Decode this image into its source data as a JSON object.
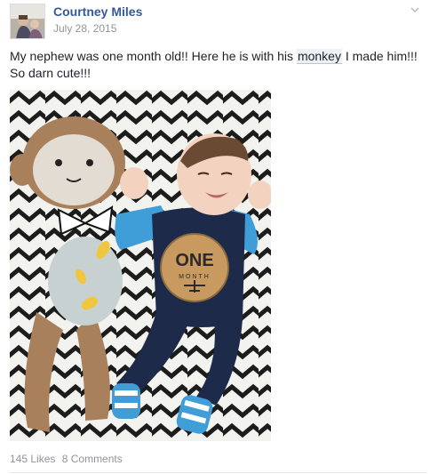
{
  "post": {
    "author": "Courtney Miles",
    "date": "July 28, 2015",
    "text_before": "My nephew was one month old!! Here he is with his ",
    "mention": "monkey",
    "text_after": " I made him!!! So darn cute!!!",
    "photo": {
      "onesie_text": "ONE",
      "onesie_subtext": "MONTH"
    },
    "stats": {
      "likes": "145 Likes",
      "comments": "8 Comments"
    }
  },
  "colors": {
    "author_link": "#365899",
    "meta_gray": "#90949c",
    "onesie_navy": "#1e2a4a",
    "sleeve_blue": "#3f9ed8",
    "monkey_brown": "#a9805c"
  },
  "icons": {
    "options": "chevron-down-icon"
  }
}
